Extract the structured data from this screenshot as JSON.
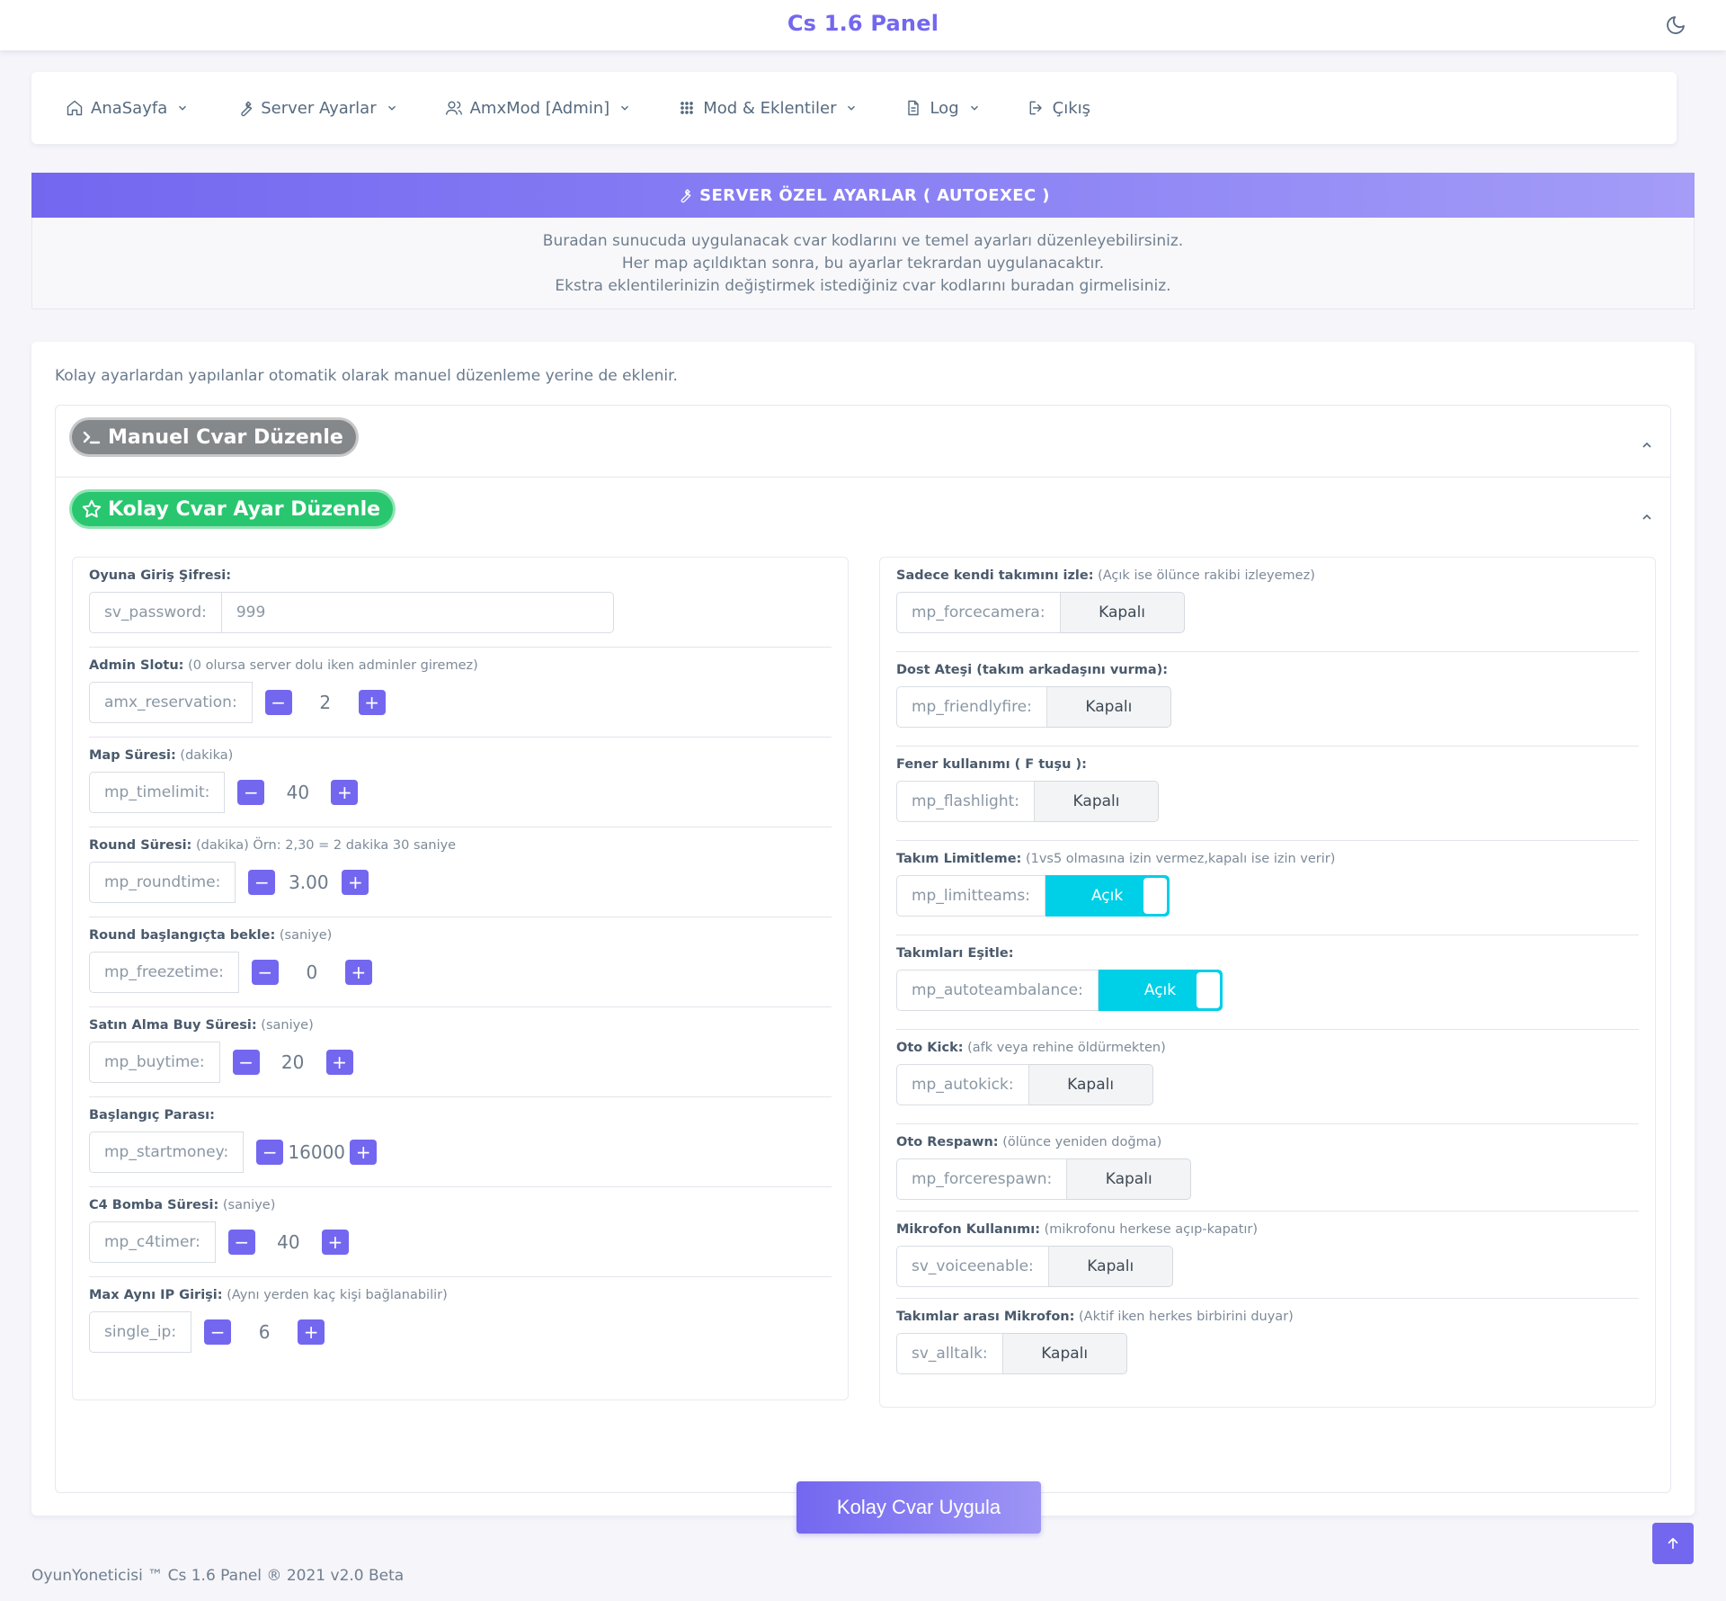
{
  "brand": "Cs 1.6 Panel",
  "nav": [
    {
      "label": "AnaSayfa",
      "icon": "home-icon",
      "dropdown": true
    },
    {
      "label": "Server Ayarlar",
      "icon": "tool-icon",
      "dropdown": true
    },
    {
      "label": "AmxMod [Admin]",
      "icon": "users-icon",
      "dropdown": true
    },
    {
      "label": "Mod & Eklentiler",
      "icon": "plugin-icon",
      "dropdown": true
    },
    {
      "label": "Log",
      "icon": "file-icon",
      "dropdown": true
    },
    {
      "label": "Çıkış",
      "icon": "logout-icon",
      "dropdown": false
    }
  ],
  "banner": {
    "title": "SERVER ÖZEL AYARLAR ( AUTOEXEC )",
    "lines": [
      "Buradan sunucuda uygulanacak cvar kodlarını ve temel ayarları düzenleyebilirsiniz.",
      "Her map açıldıktan sonra, bu ayarlar tekrardan uygulanacaktır.",
      "Ekstra eklentilerinizin değiştirmek istediğiniz cvar kodlarını buradan girmelisiniz."
    ]
  },
  "intro": "Kolay ayarlardan yapılanlar otomatik olarak manuel düzenleme yerine de eklenir.",
  "accordion": {
    "manual_label": "Manuel Cvar Düzenle",
    "easy_label": "Kolay Cvar Ayar Düzenle"
  },
  "left": [
    {
      "title": "Oyuna Giriş Şifresi:",
      "hint": "",
      "cvar": "sv_password:",
      "type": "text",
      "value": "999"
    },
    {
      "title": "Admin Slotu:",
      "hint": "(0 olursa server dolu iken adminler giremez)",
      "cvar": "amx_reservation:",
      "type": "stepper",
      "value": "2"
    },
    {
      "title": "Map Süresi:",
      "hint": "(dakika)",
      "cvar": "mp_timelimit:",
      "type": "stepper",
      "value": "40"
    },
    {
      "title": "Round Süresi:",
      "hint": "(dakika) Örn: 2,30 = 2 dakika 30 saniye",
      "cvar": "mp_roundtime:",
      "type": "stepper",
      "value": "3.00"
    },
    {
      "title": "Round başlangıçta bekle:",
      "hint": "(saniye)",
      "cvar": "mp_freezetime:",
      "type": "stepper",
      "value": "0"
    },
    {
      "title": "Satın Alma Buy Süresi:",
      "hint": "(saniye)",
      "cvar": "mp_buytime:",
      "type": "stepper",
      "value": "20"
    },
    {
      "title": "Başlangıç Parası:",
      "hint": "",
      "cvar": "mp_startmoney:",
      "type": "stepper",
      "value": "16000"
    },
    {
      "title": "C4 Bomba Süresi:",
      "hint": "(saniye)",
      "cvar": "mp_c4timer:",
      "type": "stepper",
      "value": "40"
    },
    {
      "title": "Max Aynı IP Girişi:",
      "hint": "(Aynı yerden kaç kişi bağlanabilir)",
      "cvar": "single_ip:",
      "type": "stepper",
      "value": "6"
    }
  ],
  "right": [
    {
      "title": "Sadece kendi takımını izle:",
      "hint": "(Açık ise ölünce rakibi izleyemez)",
      "cvar": "mp_forcecamera:",
      "value": "Kapalı",
      "on": false
    },
    {
      "title": "Dost Ateşi (takım arkadaşını vurma):",
      "hint": "",
      "cvar": "mp_friendlyfire:",
      "value": "Kapalı",
      "on": false
    },
    {
      "title": "Fener kullanımı ( F tuşu ):",
      "hint": "",
      "cvar": "mp_flashlight:",
      "value": "Kapalı",
      "on": false
    },
    {
      "title": "Takım Limitleme:",
      "hint": "(1vs5 olmasına izin vermez,kapalı ise izin verir)",
      "cvar": "mp_limitteams:",
      "value": "Açık",
      "on": true
    },
    {
      "title": "Takımları Eşitle:",
      "hint": "",
      "cvar": "mp_autoteambalance:",
      "value": "Açık",
      "on": true
    },
    {
      "title": "Oto Kick:",
      "hint": "(afk veya rehine öldürmekten)",
      "cvar": "mp_autokick:",
      "value": "Kapalı",
      "on": false
    },
    {
      "title": "Oto Respawn:",
      "hint": "(ölünce yeniden doğma)",
      "cvar": "mp_forcerespawn:",
      "value": "Kapalı",
      "on": false
    },
    {
      "title": "Mikrofon Kullanımı:",
      "hint": "(mikrofonu herkese açıp-kapatır)",
      "cvar": "sv_voiceenable:",
      "value": "Kapalı",
      "on": false
    },
    {
      "title": "Takımlar arası Mikrofon:",
      "hint": "(Aktif iken herkes birbirini duyar)",
      "cvar": "sv_alltalk:",
      "value": "Kapalı",
      "on": false
    }
  ],
  "apply_label": "Kolay Cvar Uygula",
  "footer": "OyunYoneticisi ™ Cs 1.6 Panel ® 2021 v2.0 Beta",
  "colors": {
    "primary": "#7367f0",
    "success": "#28c76f",
    "info": "#00cfe8",
    "secondary": "#85888b"
  }
}
